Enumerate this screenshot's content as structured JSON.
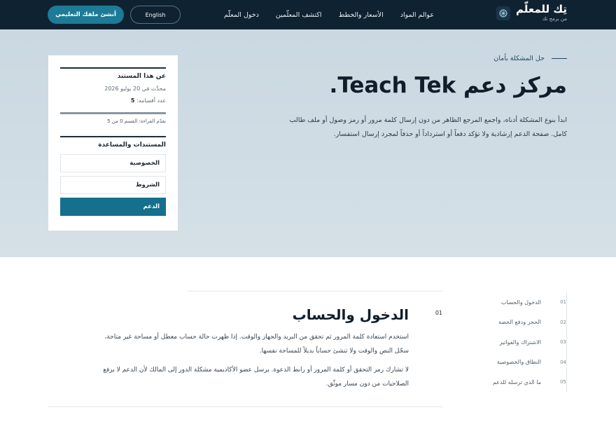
{
  "brand": {
    "name": "تِك للمعلّم",
    "tagline": "من برمج تك"
  },
  "nav": {
    "items": [
      "عوالم المواد",
      "الأسعار والخطط",
      "اكتشف المعلّمين",
      "دخول المعلّم"
    ],
    "lang_label": "English",
    "cta_label": "أنشئ ملفك التعليمي"
  },
  "hero": {
    "eyebrow": "حل المشكلة بأمان",
    "title": "مركز دعم Teach Tek.",
    "description": "ابدأ بنوع المشكلة أدناه، واجمع المرجع الظاهر من دون إرسال كلمة مرور أو رمز وصول أو ملف طالب كامل. صفحة الدعم إرشادية ولا تؤكد دفعاً أو استرداداً أو حذفاً لمجرد إرسال استفسار."
  },
  "card": {
    "about_title": "عن هذا المستند",
    "updated": "محدَّث في 20 يوليو 2026",
    "sections_label": "عدد أقسامه:",
    "sections_count": "5",
    "reading_progress": 0,
    "reading_text": "تقدّم القراءة: القسم 0 من 5",
    "docs_title": "المستندات والمساعدة",
    "docs": [
      {
        "label": "الخصوصية",
        "active": false
      },
      {
        "label": "الشروط",
        "active": false
      },
      {
        "label": "الدعم",
        "active": true
      }
    ]
  },
  "toc": [
    {
      "num": "01",
      "label": "الدخول والحساب"
    },
    {
      "num": "02",
      "label": "الحجز ودفع الحصة"
    },
    {
      "num": "03",
      "label": "الاشتراك والفواتير"
    },
    {
      "num": "04",
      "label": "النطاق والخصوصية"
    },
    {
      "num": "05",
      "label": "ما الذي ترسله للدعم"
    }
  ],
  "section": {
    "num": "01",
    "title": "الدخول والحساب",
    "p1": "استخدم استعادة كلمة المرور ثم تحقق من البريد والجهاز والوقت. إذا ظهرت حالة حساب معطل أو مساحة غير متاحة، سجّل النص والوقت ولا تنشئ حساباً بديلاً للمساحة نفسها.",
    "p2": "لا تشارك رمز التحقق أو كلمة المرور أو رابط الدعوة. يرسل عضو الأكاديمية مشكلة الدور إلى المالك لأن الدعم لا يرفع الصلاحيات من دون مسار موثّق."
  },
  "colors": {
    "header_bg": "#0f2232",
    "accent": "#1c7b96",
    "hero_bg": "#cad8e1"
  }
}
